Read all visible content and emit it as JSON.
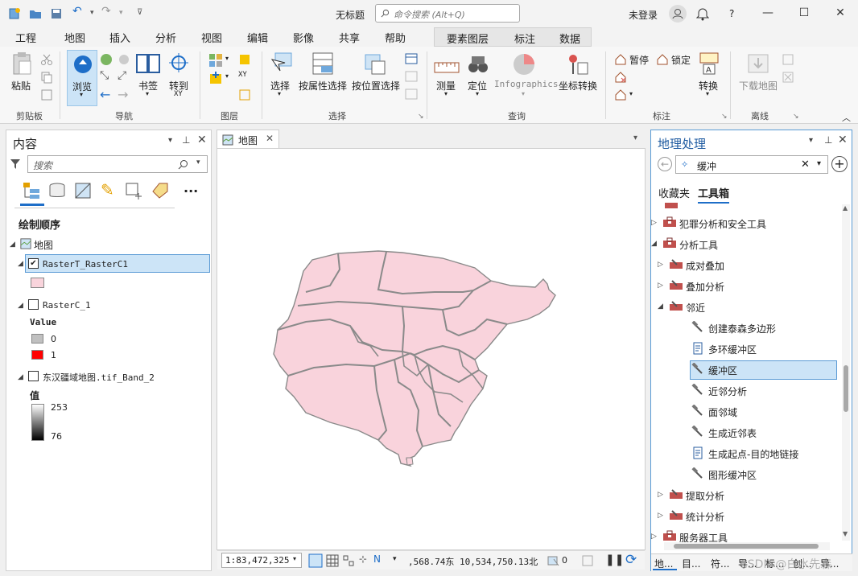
{
  "title_bar": {
    "doc_title": "无标题",
    "search_placeholder": "命令搜索 (Alt+Q)",
    "sign_in": "未登录",
    "help": "?"
  },
  "menu": {
    "tabs": [
      "工程",
      "地图",
      "插入",
      "分析",
      "视图",
      "编辑",
      "影像",
      "共享",
      "帮助"
    ],
    "active": "地图",
    "context_tabs": [
      "要素图层",
      "标注",
      "数据"
    ]
  },
  "ribbon": {
    "paste": "粘贴",
    "clipboard": "剪贴板",
    "explore": "浏览",
    "bookmark": "书签",
    "goto": "转到",
    "goto_sub": "XY",
    "navigate": "导航",
    "layer_group": "图层",
    "select": "选择",
    "select_attr": "按属性选择",
    "select_loc": "按位置选择",
    "selection": "选择",
    "measure": "测量",
    "locate": "定位",
    "infographics": "Infographics",
    "coord_convert": "坐标转换",
    "inquiry": "查询",
    "pause": "暂停",
    "lock": "锁定",
    "convert": "转换",
    "labeling": "标注",
    "download_map": "下载地图",
    "offline": "离线"
  },
  "contents": {
    "title": "内容",
    "search_placeholder": "搜索",
    "draw_order": "绘制顺序",
    "map_name": "地图",
    "layers": [
      {
        "name": "RasterT_RasterC1",
        "checked": true
      },
      {
        "name": "RasterC_1",
        "checked": false
      },
      {
        "name": "东汉疆域地图.tif_Band_2",
        "checked": false
      }
    ],
    "value_label": "Value",
    "value_items": [
      {
        "label": "0",
        "color": "#c0c0c0"
      },
      {
        "label": "1",
        "color": "#ff0000"
      }
    ],
    "band_label": "值",
    "band_high": "253",
    "band_low": "76",
    "fill_color": "#f9d4dc"
  },
  "map_view": {
    "tab": "地图",
    "scale": "1:83,472,325",
    "coords": ",568.74东 10,534,750.13北",
    "selected_count": "0",
    "polygon_fill": "#f9d3dc",
    "polygon_stroke": "#8a8a8a"
  },
  "geoprocessing": {
    "title": "地理处理",
    "search_value": "缓冲",
    "tabs": [
      "收藏夹",
      "工具箱"
    ],
    "active_tab": "工具箱",
    "items": [
      {
        "label": "犯罪分析和安全工具",
        "kind": "toolbox",
        "level": 0
      },
      {
        "label": "分析工具",
        "kind": "toolbox",
        "level": 0,
        "expanded": true
      },
      {
        "label": "成对叠加",
        "kind": "toolset",
        "level": 1
      },
      {
        "label": "叠加分析",
        "kind": "toolset",
        "level": 1
      },
      {
        "label": "邻近",
        "kind": "toolset",
        "level": 1,
        "expanded": true
      },
      {
        "label": "创建泰森多边形",
        "kind": "tool",
        "level": 2
      },
      {
        "label": "多环缓冲区",
        "kind": "script",
        "level": 2
      },
      {
        "label": "缓冲区",
        "kind": "tool",
        "level": 2,
        "selected": true
      },
      {
        "label": "近邻分析",
        "kind": "tool",
        "level": 2
      },
      {
        "label": "面邻域",
        "kind": "tool",
        "level": 2
      },
      {
        "label": "生成近邻表",
        "kind": "tool",
        "level": 2
      },
      {
        "label": "生成起点-目的地链接",
        "kind": "script",
        "level": 2
      },
      {
        "label": "图形缓冲区",
        "kind": "tool",
        "level": 2
      },
      {
        "label": "提取分析",
        "kind": "toolset",
        "level": 1
      },
      {
        "label": "统计分析",
        "kind": "toolset",
        "level": 1
      },
      {
        "label": "服务器工具",
        "kind": "toolbox",
        "level": 0
      }
    ],
    "bottom_tabs": [
      "地...",
      "目...",
      "符...",
      "导...",
      "标...",
      "创...",
      "导..."
    ],
    "watermark": "CSDN @白水先森"
  }
}
